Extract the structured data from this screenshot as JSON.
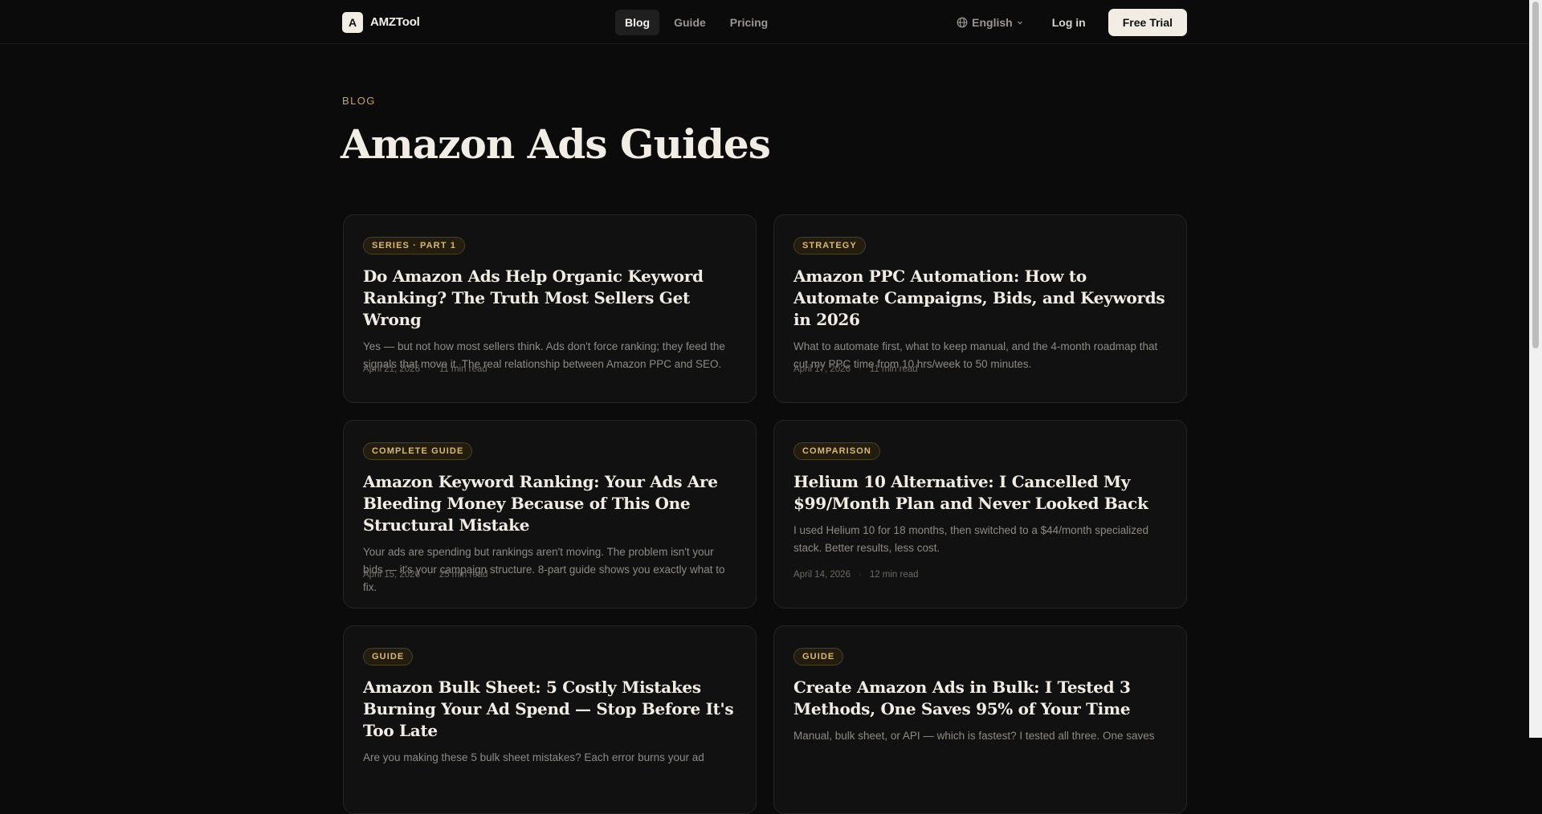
{
  "nav": {
    "logo_letter": "A",
    "brand": "AMZTool",
    "links": [
      {
        "label": "Blog",
        "active": true
      },
      {
        "label": "Guide",
        "active": false
      },
      {
        "label": "Pricing",
        "active": false
      }
    ],
    "language": "English",
    "login": "Log in",
    "cta": "Free Trial"
  },
  "header": {
    "eyebrow": "BLOG",
    "title": "Amazon Ads Guides"
  },
  "posts": [
    {
      "tag": "SERIES · PART 1",
      "title": "Do Amazon Ads Help Organic Keyword Ranking? The Truth Most Sellers Get Wrong",
      "description": "Yes — but not how most sellers think. Ads don't force ranking; they feed the signals that move it. The real relationship between Amazon PPC and SEO.",
      "date": "April 21, 2026",
      "read_time": "11 min read"
    },
    {
      "tag": "STRATEGY",
      "title": "Amazon PPC Automation: How to Automate Campaigns, Bids, and Keywords in 2026",
      "description": "What to automate first, what to keep manual, and the 4-month roadmap that cut my PPC time from 10 hrs/week to 50 minutes.",
      "date": "April 17, 2026",
      "read_time": "11 min read"
    },
    {
      "tag": "COMPLETE GUIDE",
      "title": "Amazon Keyword Ranking: Your Ads Are Bleeding Money Because of This One Structural Mistake",
      "description": "Your ads are spending but rankings aren't moving. The problem isn't your bids — it's your campaign structure. 8-part guide shows you exactly what to fix.",
      "date": "April 15, 2026",
      "read_time": "25 min read"
    },
    {
      "tag": "COMPARISON",
      "title": "Helium 10 Alternative: I Cancelled My $99/Month Plan and Never Looked Back",
      "description": "I used Helium 10 for 18 months, then switched to a $44/month specialized stack. Better results, less cost.",
      "date": "April 14, 2026",
      "read_time": "12 min read"
    },
    {
      "tag": "GUIDE",
      "title": "Amazon Bulk Sheet: 5 Costly Mistakes Burning Your Ad Spend — Stop Before It's Too Late",
      "description": "Are you making these 5 bulk sheet mistakes? Each error burns your ad",
      "date": "",
      "read_time": ""
    },
    {
      "tag": "GUIDE",
      "title": "Create Amazon Ads in Bulk: I Tested 3 Methods, One Saves 95% of Your Time",
      "description": "Manual, bulk sheet, or API — which is fastest? I tested all three. One saves",
      "date": "",
      "read_time": ""
    }
  ]
}
